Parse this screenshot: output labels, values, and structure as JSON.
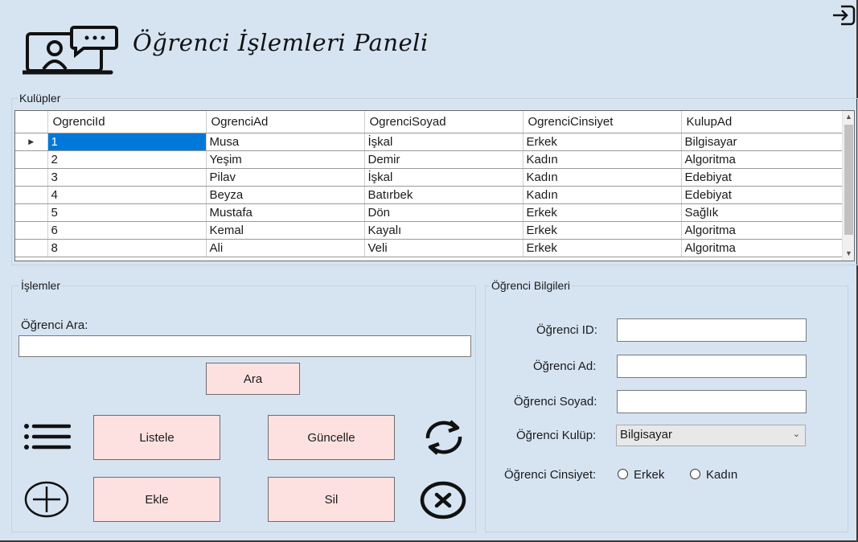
{
  "header": {
    "title": "Öğrenci İşlemleri Paneli",
    "app_icon": "presentation-user-icon",
    "logout_icon": "logout-icon"
  },
  "clubs_group": {
    "label": "Kulüpler"
  },
  "grid": {
    "columns": [
      "OgrenciId",
      "OgrenciAd",
      "OgrenciSoyad",
      "OgrenciCinsiyet",
      "KulupAd"
    ],
    "rows": [
      [
        "1",
        "Musa",
        "İşkal",
        "Erkek",
        "Bilgisayar"
      ],
      [
        "2",
        "Yeşim",
        "Demir",
        "Kadın",
        "Algoritma"
      ],
      [
        "3",
        "Pilav",
        "İşkal",
        "Kadın",
        "Edebiyat"
      ],
      [
        "4",
        "Beyza",
        "Batırbek",
        "Kadın",
        "Edebiyat"
      ],
      [
        "5",
        "Mustafa",
        "Dön",
        "Erkek",
        "Sağlık"
      ],
      [
        "6",
        "Kemal",
        "Kayalı",
        "Erkek",
        "Algoritma"
      ],
      [
        "8",
        "Ali",
        "Veli",
        "Erkek",
        "Algoritma"
      ]
    ],
    "selected_row": 0,
    "selection_color": "#0078d7"
  },
  "operations": {
    "group_label": "İşlemler",
    "search_label": "Öğrenci Ara:",
    "search_value": "",
    "search_button": "Ara",
    "list_button": "Listele",
    "update_button": "Güncelle",
    "add_button": "Ekle",
    "delete_button": "Sil",
    "icons": [
      "list-icon",
      "refresh-icon",
      "add-circle-icon",
      "delete-circle-icon"
    ]
  },
  "student_info": {
    "group_label": "Öğrenci Bilgileri",
    "id_label": "Öğrenci ID:",
    "id_value": "",
    "name_label": "Öğrenci Ad:",
    "name_value": "",
    "surname_label": "Öğrenci Soyad:",
    "surname_value": "",
    "club_label": "Öğrenci Kulüp:",
    "club_value": "Bilgisayar",
    "gender_label": "Öğrenci Cinsiyet:",
    "gender_options": [
      "Erkek",
      "Kadın"
    ]
  },
  "colors": {
    "background": "#d6e4f2",
    "button": "#fde1e1"
  }
}
